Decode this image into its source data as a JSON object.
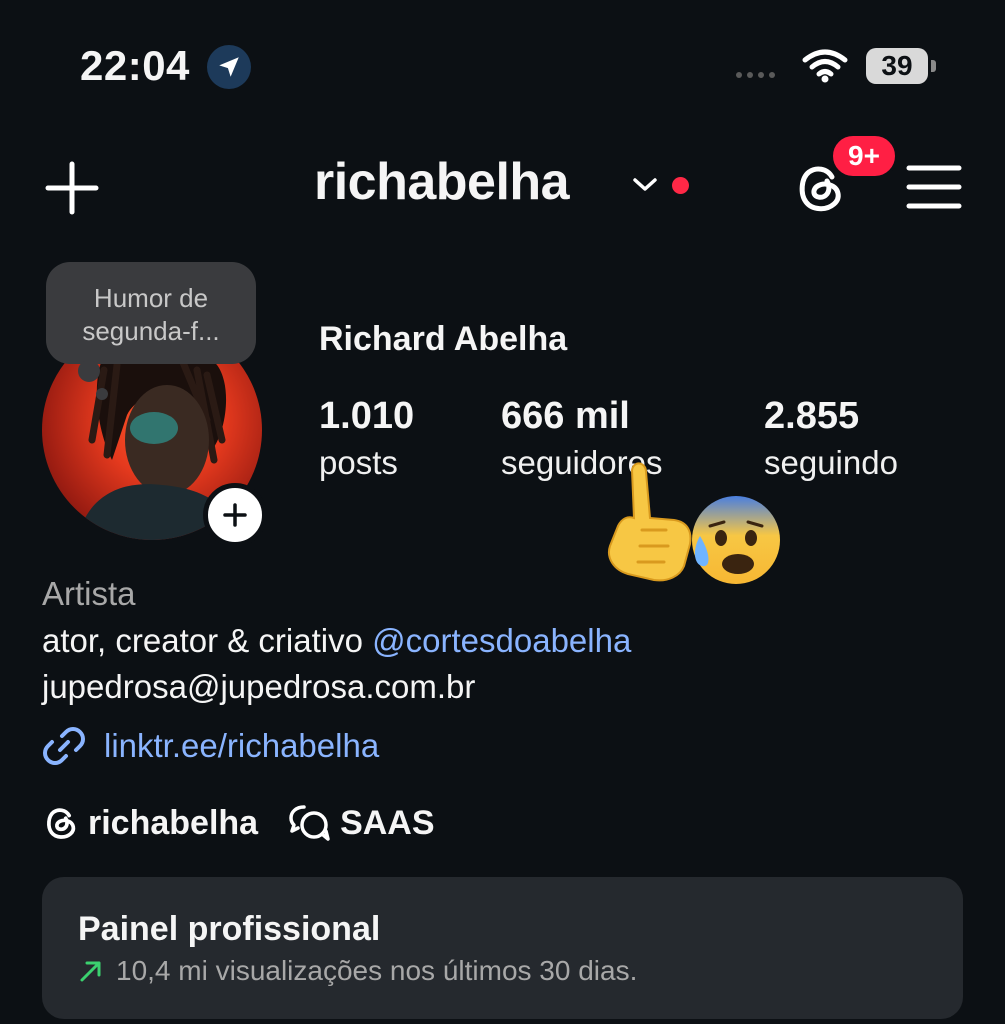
{
  "status_bar": {
    "time": "22:04",
    "battery": "39",
    "icons": [
      "location-arrow-icon",
      "cellular-signal-icon",
      "wifi-icon",
      "battery-icon"
    ]
  },
  "header": {
    "username": "richabelha",
    "notification_badge": "9+",
    "icons": [
      "plus-icon",
      "chevron-down-icon",
      "threads-icon",
      "hamburger-menu-icon"
    ],
    "accent_red": "#ff2846"
  },
  "profile": {
    "note": "Humor de segunda-f...",
    "full_name": "Richard Abelha",
    "stats": [
      {
        "value": "1.010",
        "label": "posts"
      },
      {
        "value": "666 mil",
        "label": "seguidores"
      },
      {
        "value": "2.855",
        "label": "seguindo"
      }
    ],
    "emojis": [
      "pointing-up-emoji",
      "anxious-face-with-sweat-emoji"
    ]
  },
  "bio": {
    "category": "Artista",
    "line1_text": "ator, creator & criativo ",
    "mention": "@cortesdoabelha",
    "email": "jupedrosa@jupedrosa.com.br",
    "link": "linktr.ee/richabelha",
    "link_color": "#8ab4ff"
  },
  "chips": [
    {
      "icon": "threads-icon",
      "label": "richabelha"
    },
    {
      "icon": "chat-bubbles-icon",
      "label": "SAAS"
    }
  ],
  "dashboard": {
    "title": "Painel profissional",
    "subtitle": "10,4 mi visualizações nos últimos 30 dias.",
    "trend_color": "#3bd16f"
  }
}
